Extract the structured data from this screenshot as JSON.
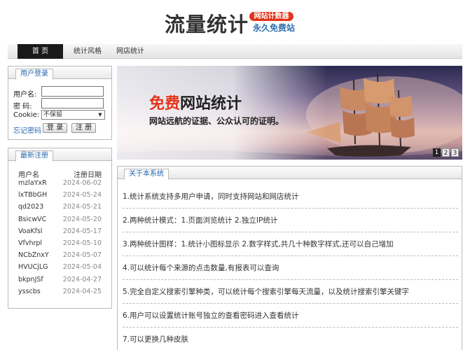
{
  "header": {
    "logo_text": "流量统计",
    "badge": "网站计数器",
    "slogan": "永久免费站"
  },
  "nav": [
    {
      "label": "首 页"
    },
    {
      "label": "统计风格"
    },
    {
      "label": "网店统计"
    }
  ],
  "login": {
    "title": "用户登录",
    "username_label": "用户名:",
    "password_label": "密  码:",
    "cookie_label": "Cookie:",
    "cookie_value": "不保留",
    "forgot": "忘记密码",
    "login_btn": "登 录",
    "register_btn": "注 册"
  },
  "recent": {
    "title": "最新注册",
    "col_user": "用户名",
    "col_date": "注册日期",
    "rows": [
      {
        "user": "mzlaYxR",
        "date": "2024-06-02"
      },
      {
        "user": "lxTBbGH",
        "date": "2024-05-24"
      },
      {
        "user": "qd2023",
        "date": "2024-05-21"
      },
      {
        "user": "BsicwVC",
        "date": "2024-05-20"
      },
      {
        "user": "VoaKfsl",
        "date": "2024-05-17"
      },
      {
        "user": "Vfvhrpl",
        "date": "2024-05-10"
      },
      {
        "user": "NCbZnxY",
        "date": "2024-05-07"
      },
      {
        "user": "HVUCjLG",
        "date": "2024-05-04"
      },
      {
        "user": "bkpnJSf",
        "date": "2024-04-27"
      },
      {
        "user": "ysscbs",
        "date": "2024-04-25"
      }
    ]
  },
  "banner": {
    "title_highlight": "免费",
    "title_rest": "网站统计",
    "subtitle": "网站远航的证据、公众认可的证明。",
    "pages": [
      "1",
      "2",
      "3"
    ]
  },
  "about": {
    "title": "关于本系统",
    "items": [
      "1.统计系统支持多用户申请，同时支持网站和网店统计",
      "2.两种统计模式：1.页面浏览统计 2.独立IP统计",
      "3.两种统计图样：1.统计小图标显示 2.数字样式,共几十种数字样式,还可以自己增加",
      "4.可以统计每个来源的点击数量,有报表可以查询",
      "5.完全自定义搜索引擎种类，可以统计每个搜索引擎每天流量，以及统计搜索引擎关键字",
      "6.用户可以设置统计账号独立的查看密码进入查看统计",
      "7.可以更换几种皮肤"
    ]
  },
  "colors": {
    "accent": "#e4341a",
    "link": "#2a66ad"
  }
}
